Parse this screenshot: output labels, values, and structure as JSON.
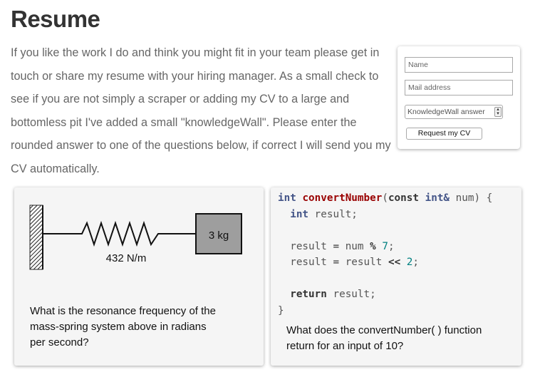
{
  "page": {
    "title": "Resume",
    "intro": "If you like the work I do and think you might fit in your team please get in touch or share my resume with your hiring manager. As a small check to see if you are not simply a scraper or adding my CV to a large and bottomless pit I've added a small \"knowledgeWall\". Please enter the rounded answer to one of the questions below, if correct I will send you my CV automatically."
  },
  "form": {
    "name_placeholder": "Name",
    "mail_placeholder": "Mail address",
    "answer_placeholder": "KnowledgeWall answer",
    "submit_label": "Request my CV"
  },
  "questions": {
    "physics": {
      "mass_label": "3 kg",
      "spring_label": "432 N/m",
      "text": "What is the resonance frequency of the mass-spring system above in radians per second?"
    },
    "code": {
      "line1": {
        "t1": "int",
        "t2": "convertNumber",
        "t3": "(",
        "t4": "const",
        "t5": "int&",
        "t6": " num) {"
      },
      "line2": {
        "t1": "int",
        "t2": " result;"
      },
      "line4": {
        "t1": "result ",
        "t2": "=",
        "t3": " num ",
        "t4": "%",
        "t5": "7",
        "t6": ";"
      },
      "line5": {
        "t1": "result ",
        "t2": "=",
        "t3": " result ",
        "t4": "<<",
        "t5": "2",
        "t6": ";"
      },
      "line7": {
        "t1": "return",
        "t2": " result;"
      },
      "line8": "}",
      "text": "What does the convertNumber( ) function return for an input of 10?"
    }
  }
}
